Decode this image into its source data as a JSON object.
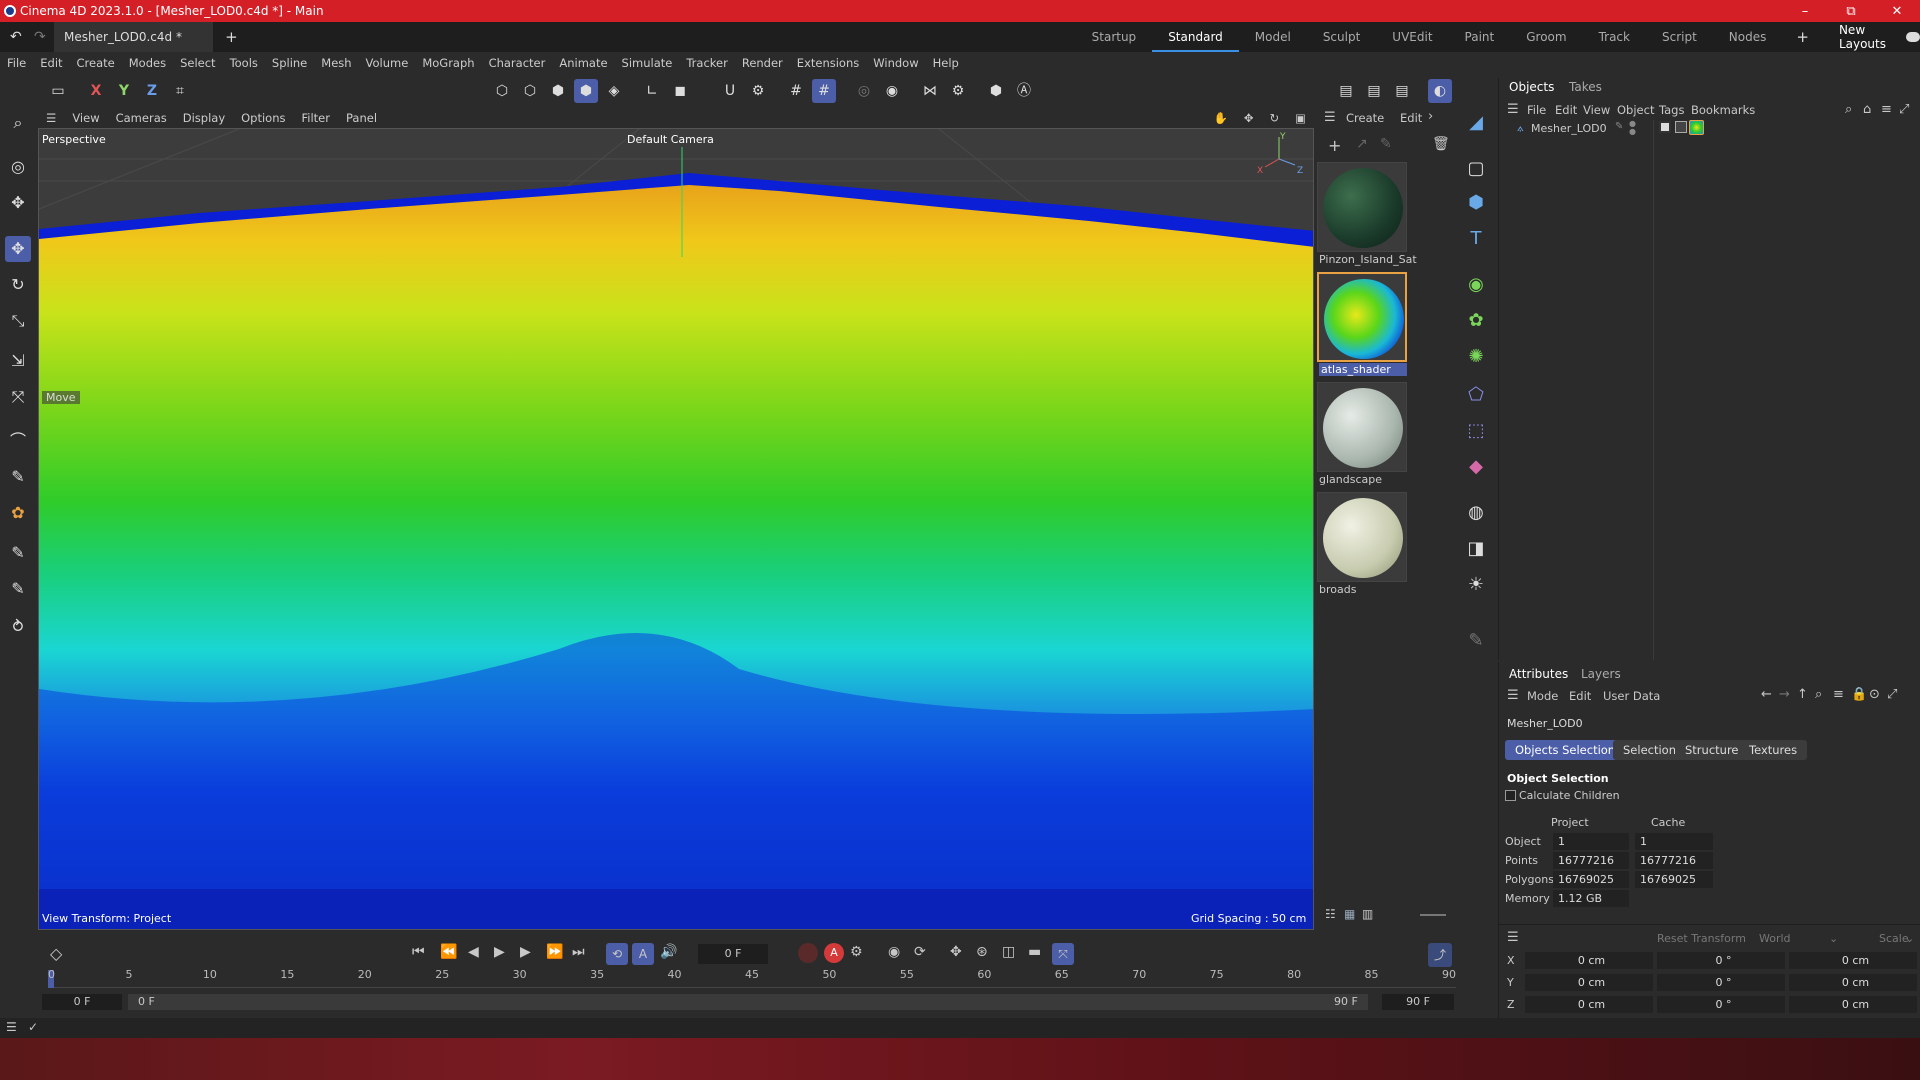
{
  "window": {
    "title": "Cinema 4D 2023.1.0 - [Mesher_LOD0.c4d *] - Main",
    "minimize": "–",
    "maximize": "⧉",
    "close": "✕"
  },
  "tabs": {
    "document": "Mesher_LOD0.c4d *",
    "close": "✕",
    "add": "+",
    "layouts": [
      "Startup",
      "Standard",
      "Model",
      "Sculpt",
      "UVEdit",
      "Paint",
      "Groom",
      "Track",
      "Script",
      "Nodes"
    ],
    "active_layout": "Standard",
    "new_layouts": "New Layouts"
  },
  "menu": [
    "File",
    "Edit",
    "Create",
    "Modes",
    "Select",
    "Tools",
    "Spline",
    "Mesh",
    "Volume",
    "MoGraph",
    "Character",
    "Animate",
    "Simulate",
    "Tracker",
    "Render",
    "Extensions",
    "Window",
    "Help"
  ],
  "toolbar": {
    "axis_x": "X",
    "axis_y": "Y",
    "axis_z": "Z"
  },
  "viewport": {
    "menu": [
      "View",
      "Cameras",
      "Display",
      "Options",
      "Filter",
      "Panel"
    ],
    "mode": "Perspective",
    "camera": "Default Camera",
    "tool_hint": "Move",
    "view_transform": "View Transform: Project",
    "grid_spacing": "Grid Spacing : 50 cm",
    "axis_x": "X",
    "axis_y": "Y",
    "axis_z": "Z"
  },
  "materials": {
    "menu": [
      "Create",
      "Edit"
    ],
    "items": [
      {
        "name": "Pinzon_Island_Sat"
      },
      {
        "name": "atlas_shader"
      },
      {
        "name": "glandscape"
      },
      {
        "name": "broads"
      }
    ]
  },
  "objects": {
    "tabs": [
      "Objects",
      "Takes"
    ],
    "active_tab": "Objects",
    "menu": [
      "File",
      "Edit",
      "View",
      "Object",
      "Tags",
      "Bookmarks"
    ],
    "rows": [
      {
        "name": "Mesher_LOD0"
      }
    ]
  },
  "attributes": {
    "tabs": [
      "Attributes",
      "Layers"
    ],
    "active_tab": "Attributes",
    "menu": [
      "Mode",
      "Edit",
      "User Data"
    ],
    "object_name": "Mesher_LOD0",
    "subtabs": [
      "Objects Selection",
      "Selection",
      "Structure",
      "Textures"
    ],
    "active_subtab": "Objects Selection",
    "section_title": "Object Selection",
    "calculate_children": "Calculate Children",
    "columns": [
      "Project",
      "Cache"
    ],
    "stats": [
      {
        "label": "Object",
        "project": "1",
        "cache": "1"
      },
      {
        "label": "Points",
        "project": "16777216",
        "cache": "16777216"
      },
      {
        "label": "Polygons",
        "project": "16769025",
        "cache": "16769025"
      },
      {
        "label": "Memory",
        "project": "1.12 GB",
        "cache": ""
      }
    ]
  },
  "coords": {
    "reset": "Reset Transform",
    "space": "World",
    "mode": "Scale",
    "rows": [
      {
        "axis": "X",
        "pos": "0 cm",
        "rot": "0 °",
        "scale": "0 cm"
      },
      {
        "axis": "Y",
        "pos": "0 cm",
        "rot": "0 °",
        "scale": "0 cm"
      },
      {
        "axis": "Z",
        "pos": "0 cm",
        "rot": "0 °",
        "scale": "0 cm"
      }
    ]
  },
  "timeline": {
    "current_frame": "0 F",
    "ruler": [
      "0",
      "5",
      "10",
      "15",
      "20",
      "25",
      "30",
      "35",
      "40",
      "45",
      "50",
      "55",
      "60",
      "65",
      "70",
      "75",
      "80",
      "85",
      "90"
    ],
    "start": "0 F",
    "range_start": "0 F",
    "range_end": "90 F",
    "end": "90 F"
  },
  "colors": {
    "titlebar": "#d41f27",
    "accent": "#4c5ea8",
    "selection_outline": "#e8a244"
  }
}
